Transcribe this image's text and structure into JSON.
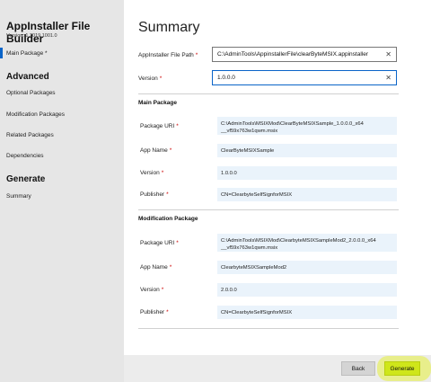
{
  "app": {
    "title": "AppInstaller File Builder",
    "version": "Version: 1.2019.1001.0"
  },
  "window_controls": {
    "minimize": "—",
    "maximize": "☐",
    "close": "✕"
  },
  "sidebar": {
    "main_item": "Main Package *",
    "advanced_title": "Advanced",
    "advanced_items": [
      "Optional Packages",
      "Modification Packages",
      "Related Packages",
      "Dependencies"
    ],
    "generate_title": "Generate",
    "generate_items": [
      "Summary"
    ]
  },
  "summary": {
    "title": "Summary",
    "path_label": "AppInstaller File Path",
    "path_value": "C:\\AdminTools\\AppinstallerFile\\clearByteMSIX.appinstaller",
    "version_label": "Version",
    "version_value": "1.0.0.0",
    "required_mark": "*"
  },
  "main_package": {
    "title": "Main Package",
    "uri_label": "Package URI",
    "uri_line1": "C:\\AdminTools\\MSIXMod\\ClearByteMSIXSample_1.0.0.0_x64",
    "uri_line2": "__vf59x763w1qwm.msix",
    "name_label": "App Name",
    "name_value": "ClearByteMSIXSample",
    "version_label": "Version",
    "version_value": "1.0.0.0",
    "publisher_label": "Publisher",
    "publisher_value": "CN=ClearbyteSelfSignforMSIX"
  },
  "modification_package": {
    "title": "Modification Package",
    "uri_label": "Package URI",
    "uri_line1": "C:\\AdminTools\\MSIXMod\\ClearbyteMSIXSampleMod2_2.0.0.0_x64",
    "uri_line2": "__vf59x763w1qwm.msix",
    "name_label": "App Name",
    "name_value": "ClearbyteMSIXSampleMod2",
    "version_label": "Version",
    "version_value": "2.0.0.0",
    "publisher_label": "Publisher",
    "publisher_value": "CN=ClearbyteSelfSignforMSIX"
  },
  "footer": {
    "back_label": "Back",
    "generate_label": "Generate"
  },
  "colors": {
    "accent": "#0a64c8",
    "sidebar_bg": "#e6e6e6",
    "readonly_bg": "#eaf3fb",
    "highlight": "#e6f03c"
  }
}
